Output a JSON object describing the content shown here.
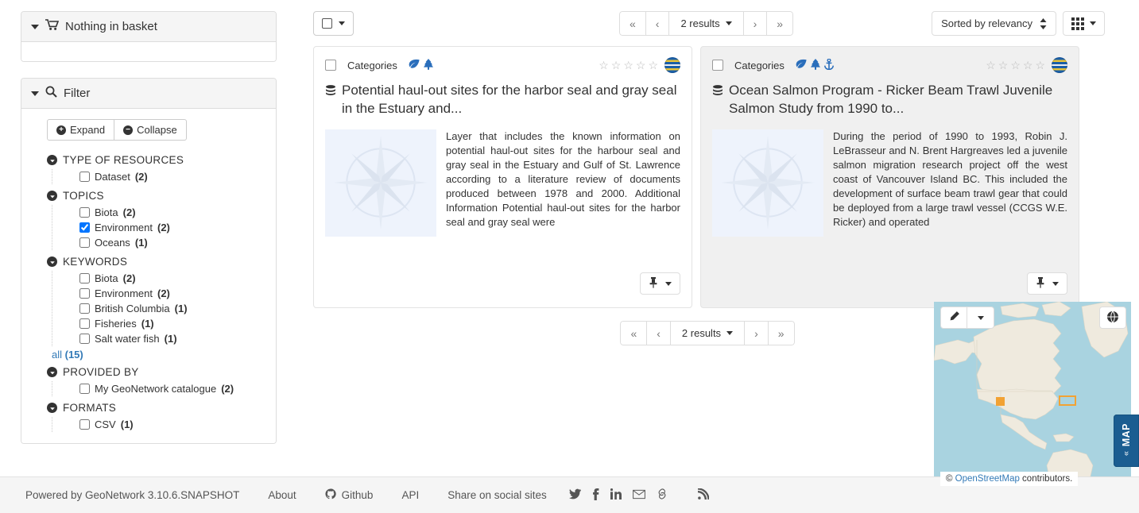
{
  "sidebar": {
    "basket": {
      "title": "Nothing in basket",
      "icon": "cart-icon"
    },
    "filter": {
      "title": "Filter",
      "icon": "search-icon",
      "expand_label": "Expand",
      "collapse_label": "Collapse",
      "groups": [
        {
          "title": "TYPE OF RESOURCES",
          "items": [
            {
              "label": "Dataset",
              "count": "(2)",
              "checked": false
            }
          ]
        },
        {
          "title": "TOPICS",
          "items": [
            {
              "label": "Biota",
              "count": "(2)",
              "checked": false
            },
            {
              "label": "Environment",
              "count": "(2)",
              "checked": true
            },
            {
              "label": "Oceans",
              "count": "(1)",
              "checked": false
            }
          ]
        },
        {
          "title": "KEYWORDS",
          "items": [
            {
              "label": "Biota",
              "count": "(2)",
              "checked": false
            },
            {
              "label": "Environment",
              "count": "(2)",
              "checked": false
            },
            {
              "label": "British Columbia",
              "count": "(1)",
              "checked": false
            },
            {
              "label": "Fisheries",
              "count": "(1)",
              "checked": false
            },
            {
              "label": "Salt water fish",
              "count": "(1)",
              "checked": false
            }
          ],
          "more_label": "all ",
          "more_count": "(15)"
        },
        {
          "title": "PROVIDED BY",
          "items": [
            {
              "label": "My GeoNetwork catalogue",
              "count": "(2)",
              "checked": false
            }
          ]
        },
        {
          "title": "FORMATS",
          "items": [
            {
              "label": "CSV",
              "count": "(1)",
              "checked": false
            }
          ]
        }
      ]
    }
  },
  "toolbar": {
    "select_all_label": "",
    "pager": {
      "first": "«",
      "prev": "‹",
      "results": "2 results",
      "next": "›",
      "last": "»"
    },
    "sort_label": "Sorted by relevancy",
    "view_label": ""
  },
  "results": [
    {
      "categories_label": "Categories",
      "category_icons": [
        "leaf-icon",
        "tree-icon"
      ],
      "rating": 0,
      "rating_max": 5,
      "title": "Potential haul-out sites for the harbor seal and gray seal in the Estuary and...",
      "abstract": "Layer that includes the known information on potential haul-out sites for the harbour seal and gray seal in the Estuary and Gulf of St. Lawrence according to a literature review of documents produced between 1978 and 2000. Additional Information Potential haul-out sites for the harbor seal and gray seal were",
      "hovered": false,
      "has_pin_button": true
    },
    {
      "categories_label": "Categories",
      "category_icons": [
        "leaf-icon",
        "tree-icon",
        "anchor-icon"
      ],
      "rating": 0,
      "rating_max": 5,
      "title": "Ocean Salmon Program - Ricker Beam Trawl Juvenile Salmon Study from 1990 to...",
      "abstract": "During the period of 1990 to 1993, Robin J. LeBrasseur and N. Brent Hargreaves led a juvenile salmon migration research project off the west coast of Vancouver Island BC. This included the development of surface beam trawl gear that could be deployed from a large trawl vessel (CCGS W.E. Ricker) and operated",
      "hovered": true,
      "has_pin_button": true
    }
  ],
  "footer": {
    "powered_by": "Powered by GeoNetwork 3.10.6.SNAPSHOT",
    "about": "About",
    "github": "Github",
    "api": "API",
    "share": "Share on social sites",
    "socials": [
      "twitter-icon",
      "facebook-icon",
      "linkedin-icon",
      "mail-icon",
      "link-icon",
      "rss-icon"
    ]
  },
  "map": {
    "draw_tool": "pencil-icon",
    "draw_dropdown": "chevron-down-icon",
    "layers_button": "globe-icon",
    "attribution_prefix": "© ",
    "attribution_link": "OpenStreetMap",
    "attribution_suffix": " contributors.",
    "tab_label": "MAP",
    "tab_chevron": "»",
    "water_color": "#a9d3e0",
    "land_color": "#efeade",
    "bbox_color": "#f2a233"
  }
}
